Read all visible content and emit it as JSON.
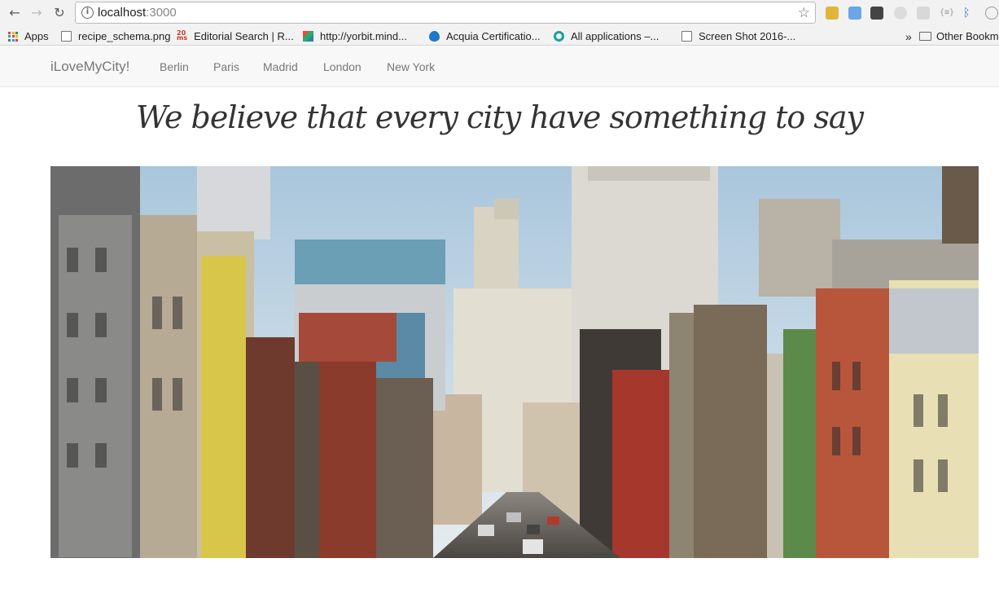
{
  "browser": {
    "url_host": "localhost",
    "url_port": ":3000",
    "bookmarks": [
      {
        "label": "Apps",
        "icon": "apps-grid-icon"
      },
      {
        "label": "recipe_schema.png",
        "icon": "page-icon"
      },
      {
        "label": "Editorial Search | R...",
        "icon": "ms-logo-icon"
      },
      {
        "label": "http://yorbit.mind...",
        "icon": "cube-icon"
      },
      {
        "label": "Acquia Certificatio...",
        "icon": "drupal-drop-icon"
      },
      {
        "label": "All applications –...",
        "icon": "ring-icon"
      },
      {
        "label": "Screen Shot 2016-...",
        "icon": "page-icon"
      }
    ],
    "overflow_label": "»",
    "other_bookmarks": "Other Bookm"
  },
  "site": {
    "brand": "iLoveMyCity!",
    "nav": [
      "Berlin",
      "Paris",
      "Madrid",
      "London",
      "New York"
    ],
    "headline": "We believe that every city have something to say"
  },
  "colors": {
    "navbar_bg": "#f8f8f8",
    "nav_text": "#777777",
    "headline": "#333333"
  }
}
